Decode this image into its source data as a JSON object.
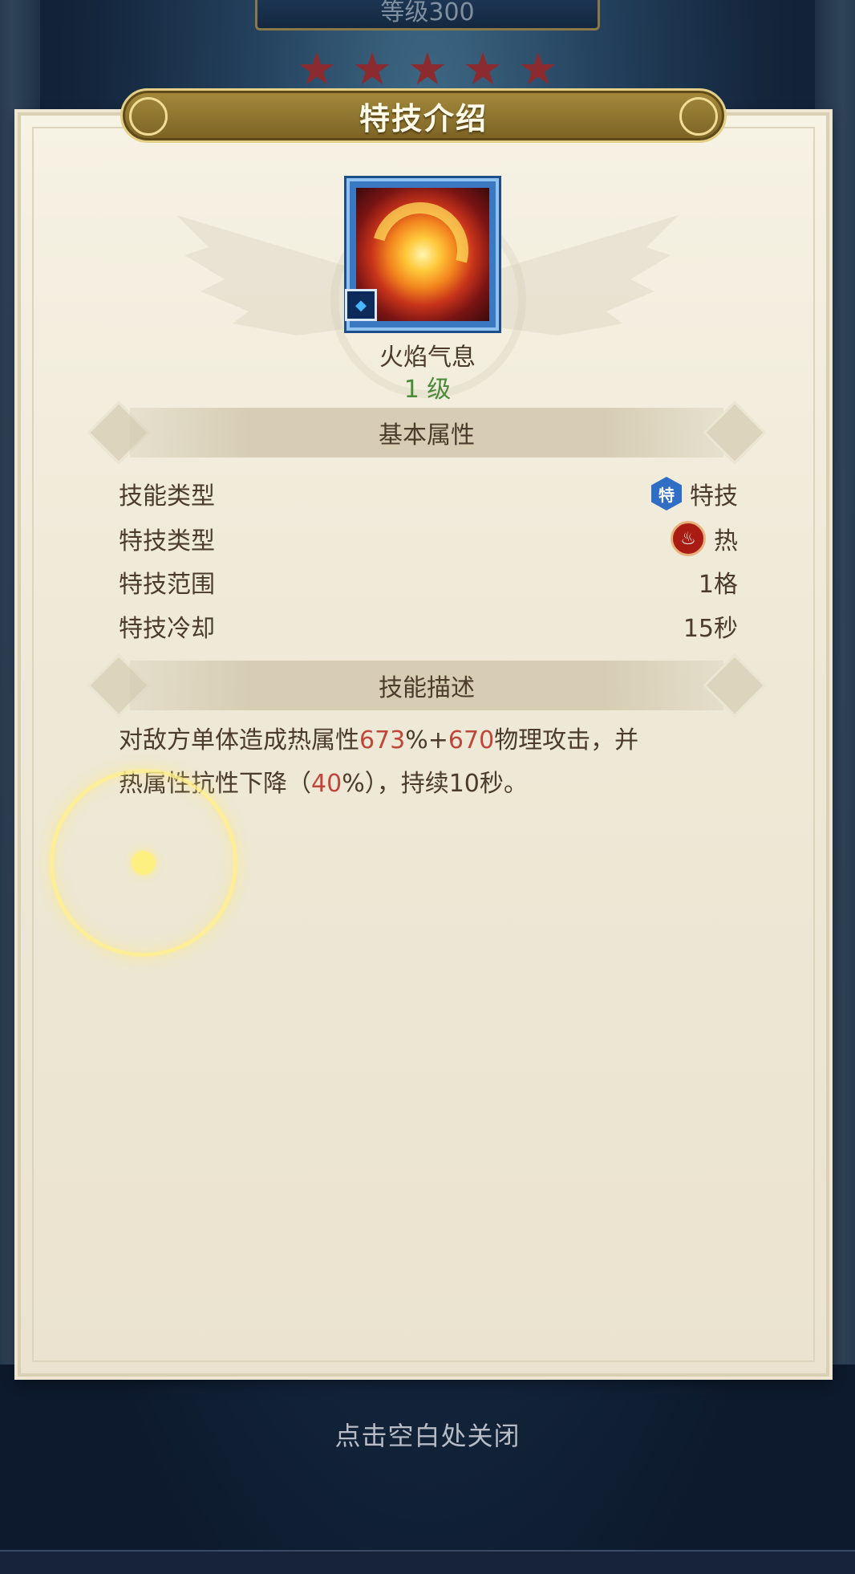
{
  "header": {
    "level_text": "等级300",
    "stars_count": 5
  },
  "dialog": {
    "title": "特技介绍"
  },
  "skill": {
    "icon": "flame-icon",
    "badge_icon": "diamond-icon",
    "name": "火焰气息",
    "level": "1 级"
  },
  "basic_section": {
    "title": "基本属性",
    "rows": [
      {
        "label": "技能类型",
        "badge": "特",
        "value": "特技"
      },
      {
        "label": "特技类型",
        "badge_icon": "fire-icon",
        "value": "热"
      },
      {
        "label": "特技范围",
        "value": "1格"
      },
      {
        "label": "特技冷却",
        "value": "15秒"
      }
    ]
  },
  "desc_section": {
    "title": "技能描述",
    "parts": {
      "p1": "对敌方单体造成热属性",
      "v1": "673",
      "p2": "%+",
      "v2": "670",
      "p3": "物理攻击，并",
      "p4": "热属性抗性下降（",
      "v3": "40",
      "p5": "%），持续10秒。"
    }
  },
  "footer": {
    "close_hint": "点击空白处关闭"
  },
  "colors": {
    "highlight": "#c0453b",
    "level_green": "#4a8a3a",
    "text": "#4b3b2b"
  }
}
